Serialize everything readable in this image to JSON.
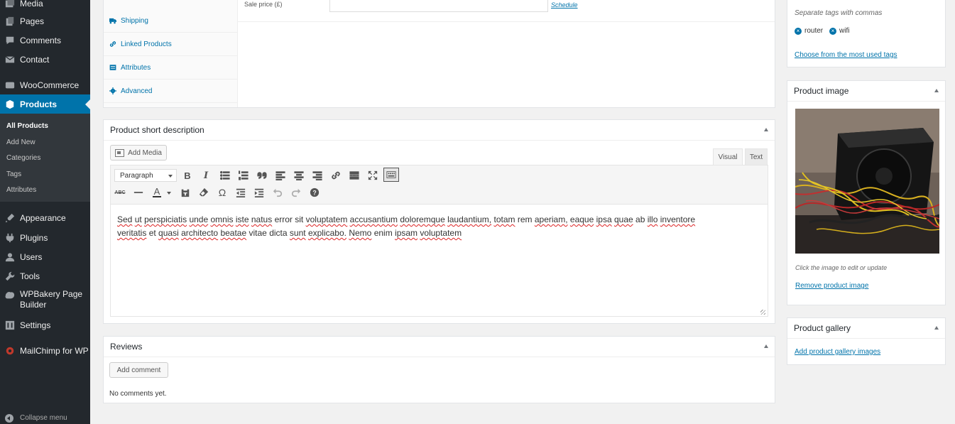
{
  "sidebar": {
    "items": [
      {
        "label": "Media",
        "icon": "media-icon"
      },
      {
        "label": "Pages",
        "icon": "pages-icon"
      },
      {
        "label": "Comments",
        "icon": "comments-icon"
      },
      {
        "label": "Contact",
        "icon": "contact-icon"
      },
      {
        "label": "WooCommerce",
        "icon": "woocommerce-icon"
      },
      {
        "label": "Products",
        "icon": "products-icon"
      },
      {
        "label": "Appearance",
        "icon": "appearance-icon"
      },
      {
        "label": "Plugins",
        "icon": "plugins-icon"
      },
      {
        "label": "Users",
        "icon": "users-icon"
      },
      {
        "label": "Tools",
        "icon": "tools-icon"
      },
      {
        "label": "WPBakery Page Builder",
        "icon": "wpbakery-icon"
      },
      {
        "label": "Settings",
        "icon": "settings-icon"
      },
      {
        "label": "MailChimp for WP",
        "icon": "mailchimp-icon"
      }
    ],
    "submenu": [
      "All Products",
      "Add New",
      "Categories",
      "Tags",
      "Attributes"
    ],
    "collapse_label": "Collapse menu"
  },
  "product_data": {
    "sale_price_label": "Sale price (£)",
    "schedule_link": "Schedule",
    "tabs": [
      "Shipping",
      "Linked Products",
      "Attributes",
      "Advanced"
    ]
  },
  "short_description": {
    "title": "Product short description",
    "add_media": "Add Media",
    "tab_visual": "Visual",
    "tab_text": "Text",
    "format_select": "Paragraph",
    "content_line1": [
      "Sed",
      "ut",
      "perspiciatis",
      "unde",
      "omnis",
      "iste",
      "natus",
      "error",
      "sit",
      "voluptatem",
      "accusantium",
      "doloremque",
      "laudantium,",
      "totam",
      "rem",
      "aperiam,",
      "eaque",
      "ipsa",
      "quae",
      "ab",
      "illo",
      "inventore"
    ],
    "content_line2": [
      "veritatis",
      "et",
      "quasi",
      "architecto",
      "beatae",
      "vitae",
      "dicta",
      "sunt",
      "explicabo.",
      "Nemo",
      "enim",
      "ipsam",
      "voluptatem"
    ]
  },
  "reviews": {
    "title": "Reviews",
    "add_comment": "Add comment",
    "empty_text": "No comments yet."
  },
  "tags_box": {
    "hint": "Separate tags with commas",
    "tags": [
      "router",
      "wifi"
    ],
    "most_used_link": "Choose from the most used tags"
  },
  "product_image": {
    "title": "Product image",
    "hint": "Click the image to edit or update",
    "remove_link": "Remove product image"
  },
  "product_gallery": {
    "title": "Product gallery",
    "add_link": "Add product gallery images"
  },
  "colors": {
    "sidebar_bg": "#23282d",
    "accent": "#0073aa",
    "page_bg": "#f1f1f1"
  }
}
